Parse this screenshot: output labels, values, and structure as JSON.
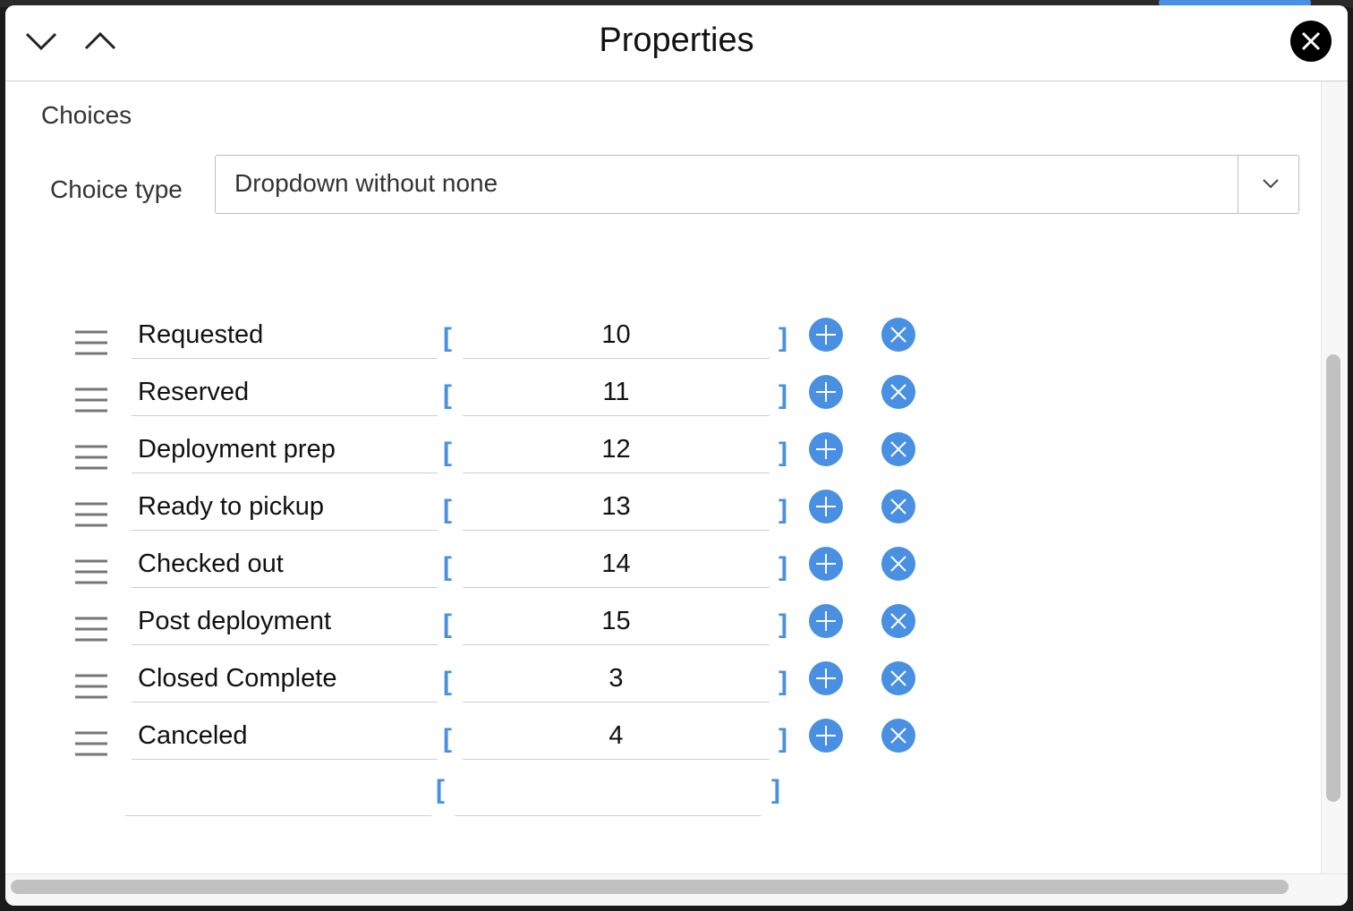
{
  "window": {
    "title": "Properties"
  },
  "section": {
    "title": "Choices"
  },
  "choice_type": {
    "label": "Choice type",
    "value": "Dropdown without none"
  },
  "choices": [
    {
      "label": "Requested",
      "value": "10"
    },
    {
      "label": "Reserved",
      "value": "11"
    },
    {
      "label": "Deployment prep",
      "value": "12"
    },
    {
      "label": "Ready to pickup",
      "value": "13"
    },
    {
      "label": "Checked out",
      "value": "14"
    },
    {
      "label": "Post deployment",
      "value": "15"
    },
    {
      "label": "Closed Complete",
      "value": "3"
    },
    {
      "label": "Canceled",
      "value": "4"
    }
  ],
  "new_choice": {
    "label": "",
    "value": ""
  },
  "brackets": {
    "open": "[",
    "close": "]"
  },
  "icons": {
    "nav_down": "chevron-down-icon",
    "nav_up": "chevron-up-icon",
    "close": "close-icon",
    "drag": "drag-handle-icon",
    "add": "plus-icon",
    "remove": "x-icon"
  },
  "colors": {
    "accent": "#4a90e2",
    "close_button": "#000000"
  }
}
